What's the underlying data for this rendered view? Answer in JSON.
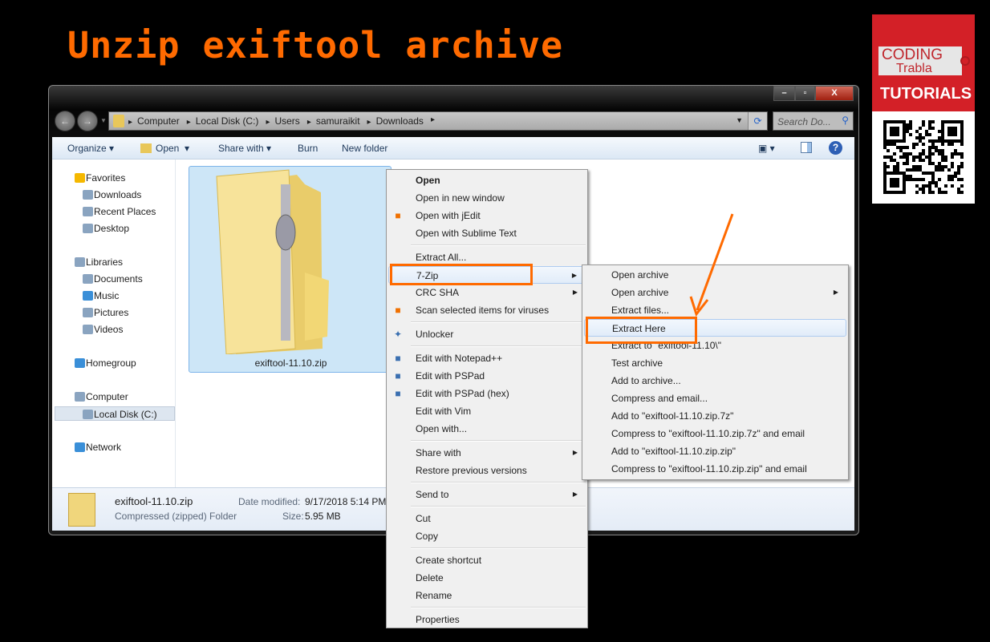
{
  "title": "Unzip exiftool archive",
  "accent": "#ff6a00",
  "logo": {
    "line1": "CODING",
    "line2": "Trabla",
    "line3": "TUTORIALS"
  },
  "window": {
    "controls": [
      "minimize",
      "maximize",
      "close"
    ],
    "breadcrumb": [
      "Computer",
      "Local Disk (C:)",
      "Users",
      "samuraikit",
      "Downloads"
    ],
    "search_placeholder": "Search Do...",
    "toolbar": {
      "organize": "Organize",
      "open": "Open",
      "share": "Share with",
      "burn": "Burn",
      "new_folder": "New folder"
    },
    "sidebar": [
      {
        "label": "Favorites",
        "icon": "star-icon",
        "group": true
      },
      {
        "label": "Downloads",
        "icon": "downloads-folder-icon"
      },
      {
        "label": "Recent Places",
        "icon": "recent-places-icon"
      },
      {
        "label": "Desktop",
        "icon": "desktop-icon"
      },
      {
        "label": "Libraries",
        "icon": "libraries-icon",
        "group": true
      },
      {
        "label": "Documents",
        "icon": "documents-icon"
      },
      {
        "label": "Music",
        "icon": "music-icon"
      },
      {
        "label": "Pictures",
        "icon": "pictures-icon"
      },
      {
        "label": "Videos",
        "icon": "videos-icon"
      },
      {
        "label": "Homegroup",
        "icon": "homegroup-icon",
        "group": true
      },
      {
        "label": "Computer",
        "icon": "computer-icon",
        "group": true
      },
      {
        "label": "Local Disk (C:)",
        "icon": "drive-icon",
        "selected": true
      },
      {
        "label": "Network",
        "icon": "network-icon",
        "group": true
      }
    ],
    "file": {
      "name": "exiftool-11.10.zip"
    },
    "details": {
      "name": "exiftool-11.10.zip",
      "type": "Compressed (zipped) Folder",
      "date_label": "Date modified:",
      "date_value": "9/17/2018 5:14 PM",
      "size_label": "Size:",
      "size_value": "5.95 MB"
    }
  },
  "context_menu": [
    {
      "label": "Open",
      "bold": true
    },
    {
      "label": "Open in new window"
    },
    {
      "label": "Open with jEdit",
      "icon": "jedit-icon"
    },
    {
      "label": "Open with Sublime Text"
    },
    {
      "sep": true
    },
    {
      "label": "Extract All..."
    },
    {
      "label": "7-Zip",
      "arrow": true,
      "highlight": true
    },
    {
      "label": "CRC SHA",
      "arrow": true
    },
    {
      "label": "Scan selected items for viruses",
      "icon": "avast-icon"
    },
    {
      "sep": true
    },
    {
      "label": "Unlocker",
      "icon": "unlocker-wand-icon"
    },
    {
      "sep": true
    },
    {
      "label": "Edit with Notepad++",
      "icon": "notepad-plus-icon"
    },
    {
      "label": "Edit with PSPad",
      "icon": "pspad-icon"
    },
    {
      "label": "Edit with PSPad (hex)",
      "icon": "pspad-icon"
    },
    {
      "label": "Edit with Vim"
    },
    {
      "label": "Open with..."
    },
    {
      "sep": true
    },
    {
      "label": "Share with",
      "arrow": true
    },
    {
      "label": "Restore previous versions"
    },
    {
      "sep": true
    },
    {
      "label": "Send to",
      "arrow": true
    },
    {
      "sep": true
    },
    {
      "label": "Cut"
    },
    {
      "label": "Copy"
    },
    {
      "sep": true
    },
    {
      "label": "Create shortcut"
    },
    {
      "label": "Delete"
    },
    {
      "label": "Rename"
    },
    {
      "sep": true
    },
    {
      "label": "Properties"
    }
  ],
  "submenu_7zip": [
    {
      "label": "Open archive"
    },
    {
      "label": "Open archive",
      "arrow": true
    },
    {
      "label": "Extract files..."
    },
    {
      "label": "Extract Here",
      "highlight": true
    },
    {
      "label": "Extract to \"exiftool-11.10\\\""
    },
    {
      "label": "Test archive"
    },
    {
      "label": "Add to archive..."
    },
    {
      "label": "Compress and email..."
    },
    {
      "label": "Add to \"exiftool-11.10.zip.7z\""
    },
    {
      "label": "Compress to \"exiftool-11.10.zip.7z\" and email"
    },
    {
      "label": "Add to \"exiftool-11.10.zip.zip\""
    },
    {
      "label": "Compress to \"exiftool-11.10.zip.zip\" and email"
    }
  ]
}
